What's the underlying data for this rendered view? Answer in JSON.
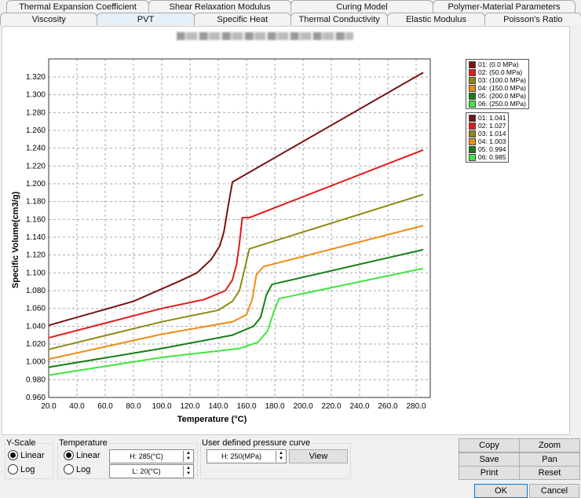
{
  "tabs_row1": [
    "Thermal Expansion Coefficient",
    "Shear Relaxation Modulus",
    "Curing Model",
    "Polymer-Material Parameters"
  ],
  "tabs_row2": [
    "Viscosity",
    "PVT",
    "Specific Heat",
    "Thermal Conductivity",
    "Elastic Modulus",
    "Poisson's Ratio"
  ],
  "active_tab": "PVT",
  "chart_data": {
    "type": "line",
    "xlabel": "Temperature (°C)",
    "ylabel": "Specific Volume(cm3/g)",
    "xlim": [
      20,
      290
    ],
    "ylim": [
      0.96,
      1.34
    ],
    "xticks": [
      "20.0",
      "40.0",
      "60.0",
      "80.0",
      "100.0",
      "120.0",
      "140.0",
      "160.0",
      "180.0",
      "200.0",
      "220.0",
      "240.0",
      "260.0",
      "280.0"
    ],
    "yticks": [
      "0.960",
      "0.980",
      "1.000",
      "1.020",
      "1.040",
      "1.060",
      "1.080",
      "1.100",
      "1.120",
      "1.140",
      "1.160",
      "1.180",
      "1.200",
      "1.220",
      "1.240",
      "1.260",
      "1.280",
      "1.300",
      "1.320"
    ],
    "grid": true,
    "legend_position": "right",
    "series": [
      {
        "name": "01: (0.0 MPa)",
        "value_label": "01: 1.041",
        "color": "#7a1212",
        "points": [
          [
            20,
            1.041
          ],
          [
            80,
            1.068
          ],
          [
            113,
            1.091
          ],
          [
            125,
            1.1
          ],
          [
            135,
            1.115
          ],
          [
            141,
            1.13
          ],
          [
            144,
            1.146
          ],
          [
            147,
            1.175
          ],
          [
            150,
            1.202
          ],
          [
            285,
            1.325
          ]
        ]
      },
      {
        "name": "02: (50.0 MPa)",
        "value_label": "02: 1.027",
        "color": "#e41a1a",
        "points": [
          [
            20,
            1.027
          ],
          [
            100,
            1.06
          ],
          [
            130,
            1.07
          ],
          [
            145,
            1.08
          ],
          [
            150,
            1.092
          ],
          [
            153,
            1.11
          ],
          [
            155,
            1.133
          ],
          [
            157,
            1.162
          ],
          [
            162,
            1.162
          ],
          [
            285,
            1.238
          ]
        ]
      },
      {
        "name": "03: (100.0 MPa)",
        "value_label": "03: 1.014",
        "color": "#8f8a14",
        "points": [
          [
            20,
            1.014
          ],
          [
            100,
            1.045
          ],
          [
            140,
            1.058
          ],
          [
            150,
            1.068
          ],
          [
            155,
            1.08
          ],
          [
            158,
            1.1
          ],
          [
            162,
            1.127
          ],
          [
            285,
            1.188
          ]
        ]
      },
      {
        "name": "04: (150.0 MPa)",
        "value_label": "04: 1.003",
        "color": "#f08c14",
        "points": [
          [
            20,
            1.003
          ],
          [
            100,
            1.031
          ],
          [
            150,
            1.045
          ],
          [
            160,
            1.053
          ],
          [
            164,
            1.07
          ],
          [
            167,
            1.098
          ],
          [
            172,
            1.107
          ],
          [
            285,
            1.153
          ]
        ]
      },
      {
        "name": "05: (200.0 MPa)",
        "value_label": "05: 0.994",
        "color": "#147e14",
        "points": [
          [
            20,
            0.994
          ],
          [
            100,
            1.015
          ],
          [
            150,
            1.03
          ],
          [
            165,
            1.04
          ],
          [
            170,
            1.05
          ],
          [
            174,
            1.075
          ],
          [
            178,
            1.087
          ],
          [
            285,
            1.126
          ]
        ]
      },
      {
        "name": "06: (250.0 MPa)",
        "value_label": "06: 0.985",
        "color": "#3ee63e",
        "points": [
          [
            20,
            0.985
          ],
          [
            100,
            1.005
          ],
          [
            155,
            1.015
          ],
          [
            168,
            1.022
          ],
          [
            175,
            1.035
          ],
          [
            179,
            1.055
          ],
          [
            183,
            1.071
          ],
          [
            285,
            1.105
          ]
        ]
      }
    ]
  },
  "yscale": {
    "title": "Y-Scale",
    "linear": "Linear",
    "log": "Log",
    "selected": "Linear"
  },
  "temperature": {
    "title": "Temperature",
    "linear": "Linear",
    "log": "Log",
    "selected": "Linear",
    "high": "H: 285(°C)",
    "low": "L: 20(°C)"
  },
  "pressure": {
    "title": "User defined pressure curve",
    "value": "H: 250(MPa)",
    "view": "View"
  },
  "buttons": {
    "copy": "Copy",
    "zoom": "Zoom",
    "save": "Save",
    "pan": "Pan",
    "print": "Print",
    "reset": "Reset",
    "ok": "OK",
    "cancel": "Cancel"
  }
}
